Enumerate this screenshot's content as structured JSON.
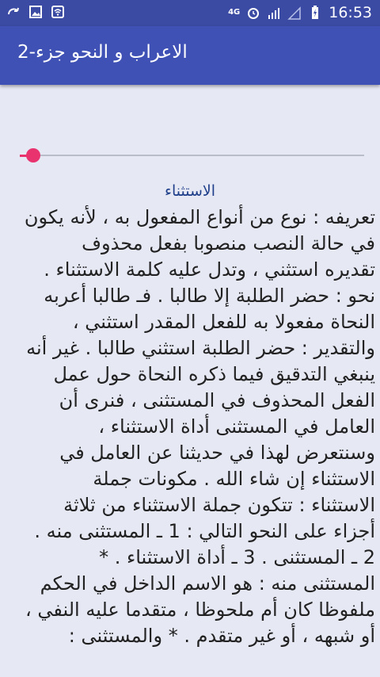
{
  "status_bar": {
    "time": "16:53",
    "network": "4G",
    "icons": [
      "sync-icon",
      "image-icon",
      "wifi-icon",
      "network-4g-icon",
      "alarm-icon",
      "signal-icon",
      "signal-empty-icon",
      "battery-charging-icon"
    ]
  },
  "app_bar": {
    "title": "الاعراب و النحو جزء-2"
  },
  "colors": {
    "primary": "#3f51b5",
    "primary_dark": "#3b4ba3",
    "accent": "#e8336f",
    "background": "#e6e8f4",
    "heading": "#1f3f8a"
  },
  "slider": {
    "progress": 0.04
  },
  "content": {
    "heading": "الاستثناء",
    "lines": [
      "تعريفه : نوع من أنواع المفعول به ، لأنه يكون",
      "في حالة النصب منصوبا بفعل محذوف",
      "تقديره  استثني  ، وتدل عليه كلمة الاستثناء .",
      "نحو : حضر الطلبة إلا طالبا . فـ  طالبا  أعربه",
      "النحاة مفعولا به للفعل المقدر  استثني  ،",
      "والتقدير : حضر الطلبة استثني طالبا . غير أنه",
      "ينبغي التدقيق فيما ذكره النحاة حول عمل",
      "الفعل المحذوف في المستثنى ، فنرى أن",
      "العامل في المستثنى أداة الاستثناء ،",
      "وسنتعرض لهذا في حديثنا عن العامل في",
      "الاستثناء إن شاء الله . مكونات جملة",
      "الاستثناء : تتكون جملة الاستثناء من ثلاثة",
      "أجزاء على النحو التالي : 1 ـ المستثنى منه .",
      "2 ـ المستثنى . 3 ـ أداة الاستثناء . *",
      "المستثنى منه : هو الاسم الداخل في الحكم",
      "ملفوظا كان أم ملحوظا ، متقدما عليه النفي ،",
      "أو شبهه ، أو غير متقدم . * والمستثنى :"
    ]
  }
}
